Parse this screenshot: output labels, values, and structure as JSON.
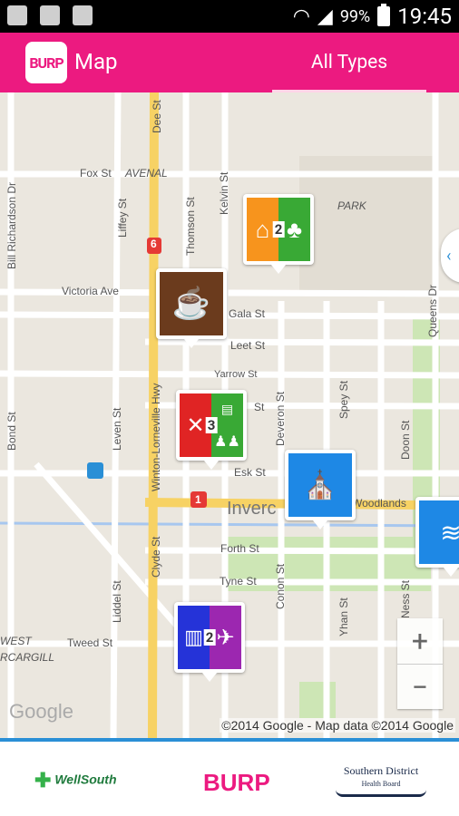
{
  "status_bar": {
    "battery_pct": "99%",
    "time": "19:45"
  },
  "app_bar": {
    "logo_text": "BURP",
    "title": "Map",
    "filter_label": "All Types"
  },
  "map": {
    "streets": {
      "fox": "Fox St",
      "avenal": "AVENAL",
      "victoria": "Victoria Ave",
      "gala": "Gala St",
      "leet": "Leet St",
      "yarrow": "Yarrow St",
      "st_short": "St",
      "esk": "Esk St",
      "woodlands": "Woodlands",
      "invercargill_big": "Inverc",
      "forth": "Forth St",
      "tyne": "Tyne St",
      "tweed": "Tweed St",
      "west": "WEST",
      "rcargill": "RCARGILL",
      "dee": "Dee St",
      "kelvin": "Kelvin St",
      "thomson": "Thomson St",
      "liffey": "Liffey St",
      "bill_richardson": "Bill Richardson Dr",
      "bond": "Bond St",
      "leven": "Leven St",
      "winton_lorneville": "Winton-Lorneville Hwy",
      "clyde": "Clyde St",
      "liddel": "Liddel St",
      "deveron": "Deveron St",
      "conon": "Conon St",
      "spey": "Spey St",
      "yhan": "Yhan St",
      "doon": "Doon St",
      "ness": "Ness St",
      "queens": "Queens Dr",
      "park": "PARK"
    },
    "highway_shields": [
      "6",
      "1"
    ],
    "markers": [
      {
        "name": "heritage-park-cluster",
        "count": "2"
      },
      {
        "name": "cafe",
        "count": ""
      },
      {
        "name": "restaurant-library-family-cluster",
        "count": "3"
      },
      {
        "name": "church",
        "count": ""
      },
      {
        "name": "swimming-pool",
        "count": ""
      },
      {
        "name": "shop-airport-cluster",
        "count": "2"
      }
    ],
    "zoom_in": "+",
    "zoom_out": "−",
    "google_logo": "Google",
    "attribution": "©2014 Google - Map data ©2014 Google"
  },
  "footer": {
    "wellsouth": "WellSouth",
    "burp": "BURP",
    "sdhb_line1": "Southern District",
    "sdhb_line2": "Health Board"
  }
}
